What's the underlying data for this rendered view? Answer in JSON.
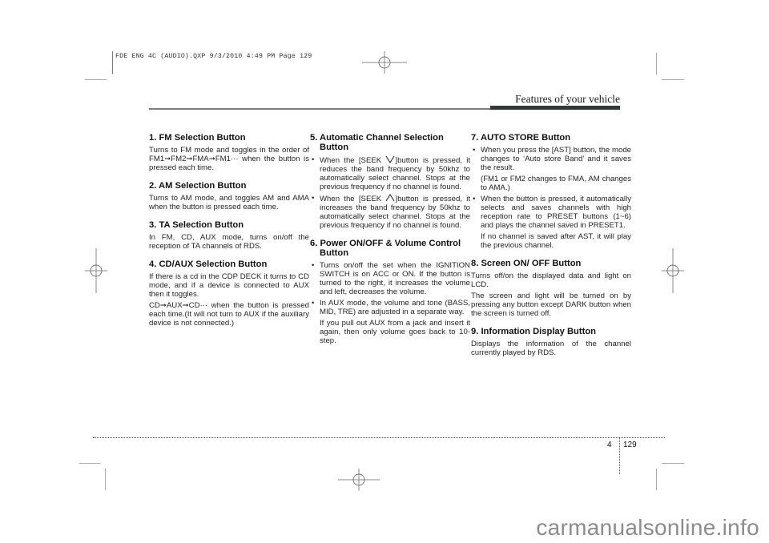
{
  "slug": "FDE ENG 4C (AUDIO).QXP  9/3/2010  4:49 PM  Page 129",
  "header": {
    "title": "Features of your vehicle"
  },
  "columns": [
    {
      "sections": [
        {
          "title": "1. FM Selection Button",
          "paragraphs": [
            "Turns to FM mode and toggles in the order of FM1➞FM2➞FMA➞FM1··· when the button is pressed each time."
          ]
        },
        {
          "title": "2. AM Selection Button",
          "paragraphs": [
            "Turns to AM mode, and toggles AM and AMA when the button is pressed each time."
          ]
        },
        {
          "title": "3. TA Selection Button",
          "paragraphs": [
            "In FM, CD, AUX mode, turns on/off the reception of TA channels of RDS."
          ]
        },
        {
          "title": "4. CD/AUX Selection Button",
          "paragraphs": [
            "If there is a cd in the CDP DECK it turns to CD mode, and if a device is connected to AUX then it toggles.",
            "CD➞AUX➞CD··· when the button is pressed each time.(It will not turn to AUX if the auxiliary device is not connected.)"
          ]
        }
      ]
    },
    {
      "sections": [
        {
          "title": "5. Automatic Channel Selection Button",
          "bullets": [
            {
              "before": "When the [SEEK ",
              "glyph": "down",
              "after": "]button is pressed, it reduces the band frequency by 50khz to automatically select channel. Stops at the previous frequency if no channel is found."
            },
            {
              "before": "When the [SEEK ",
              "glyph": "up",
              "after": "]button is pressed, it increases the band frequency by 50khz to automatically select channel. Stops at the previous frequency if no channel is found."
            }
          ]
        },
        {
          "title": "6. Power ON/OFF & Volume Control Button",
          "bullets": [
            {
              "text": "Turns on/off the set when the IGNITION SWITCH is on ACC or ON. If the button is turned to the right, it increases the volume and left, decreases the volume."
            },
            {
              "text": "In AUX mode, the volume and tone (BASS, MID, TRE) are adjusted in a separate way.",
              "extra": "If you pull out AUX from a jack and insert it again, then only volume goes back to 10-step."
            }
          ]
        }
      ]
    },
    {
      "sections": [
        {
          "title": "7. AUTO STORE Button",
          "bullets": [
            {
              "text": "When you press the [AST] button, the mode changes to ‘Auto store Band’ and it saves the result.",
              "extra": "(FM1 or FM2 changes to FMA, AM changes to AMA.)"
            },
            {
              "text": "When the button is pressed, it automatically selects and saves channels with high reception rate to PRESET buttons (1~6) and plays the channel saved in PRESET1.",
              "extra": "If no channel is saved after AST, it will play the previous channel."
            }
          ]
        },
        {
          "title": "8. Screen ON/ OFF Button",
          "paragraphs": [
            "Turns off/on the displayed data and light on LCD.",
            "The screen and light will be turned on by pressing any button except DARK button when the screen is turned off."
          ]
        },
        {
          "title": "9. Information Display Button",
          "paragraphs": [
            "Displays the information of the channel currently played by RDS."
          ]
        }
      ]
    }
  ],
  "footer": {
    "chapter": "4",
    "page": "129"
  },
  "watermark": "carmanualsonline.info",
  "icons": {
    "bullet": "•",
    "seek_down": "seek-down-chevron-icon",
    "seek_up": "seek-up-chevron-icon",
    "registration": "registration-mark-icon"
  }
}
